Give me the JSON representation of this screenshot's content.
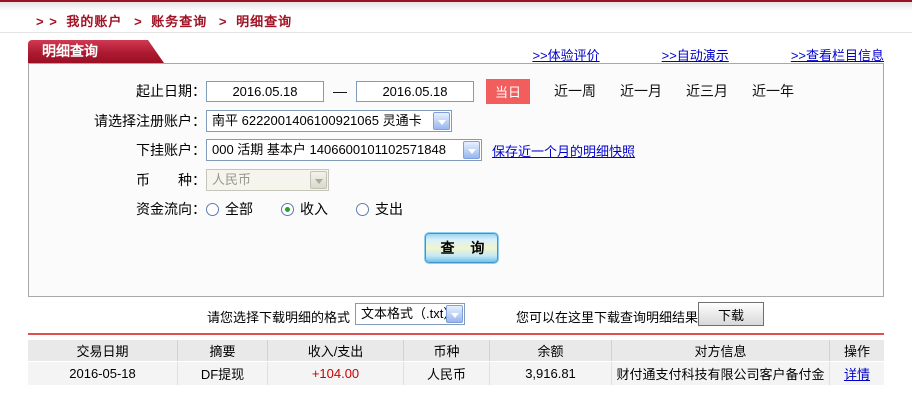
{
  "breadcrumb": {
    "prefix": "> >",
    "separator": ">",
    "items": [
      "我的账户",
      "账务查询",
      "明细查询"
    ]
  },
  "header": {
    "tab_title": "明细查询",
    "links": [
      ">>体验评价",
      ">>自动演示",
      ">>查看栏目信息"
    ]
  },
  "form": {
    "date_label": "起止日期：",
    "date_from": "2016.05.18",
    "date_to": "2016.05.18",
    "date_dash": "—",
    "today_badge": "当日",
    "quick_ranges": [
      "近一周",
      "近一月",
      "近三月",
      "近一年"
    ],
    "account_label": "请选择注册账户：",
    "account_value": "南平 6222001406100921065 灵通卡",
    "sub_account_label": "下挂账户：",
    "sub_account_value": "000 活期 基本户 1406600101102571848",
    "snapshot_link": "保存近一个月的明细快照",
    "currency_label": "币　　种：",
    "currency_value": "人民币",
    "flow_label": "资金流向：",
    "flow_options": [
      {
        "label": "全部",
        "checked": false
      },
      {
        "label": "收入",
        "checked": true
      },
      {
        "label": "支出",
        "checked": false
      }
    ],
    "query_button": "查 询"
  },
  "download": {
    "format_label": "请您选择下载明细的格式",
    "format_value": "文本格式（.txt）",
    "hint": "您可以在这里下载查询明细结果",
    "button": "下载"
  },
  "table": {
    "headers": [
      "交易日期",
      "摘要",
      "收入/支出",
      "币种",
      "余额",
      "对方信息",
      "操作"
    ],
    "row": {
      "date": "2016-05-18",
      "summary": "DF提现",
      "amount": "+104.00",
      "currency": "人民币",
      "balance": "3,916.81",
      "counterparty": "财付通支付科技有限公司客户备付金",
      "action": "详情"
    }
  },
  "colors": {
    "brand_red": "#9b1322",
    "badge_red": "#f25e5e",
    "link_blue": "#0000cc",
    "amount_red": "#cc0000"
  }
}
